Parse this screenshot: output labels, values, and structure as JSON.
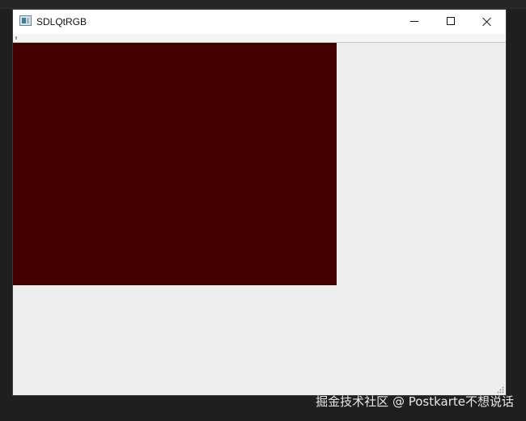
{
  "window": {
    "title": "SDLQtRGB",
    "icon": "app-window-icon",
    "controls": {
      "minimize_icon": "minimize-icon",
      "maximize_icon": "maximize-icon",
      "close_icon": "close-icon"
    }
  },
  "content": {
    "surface_color": "#420000",
    "background_color": "#eeeeee",
    "size_grip_icon": "size-grip-icon"
  },
  "watermark": {
    "text": "掘金技术社区 @ Postkarte不想说话"
  }
}
